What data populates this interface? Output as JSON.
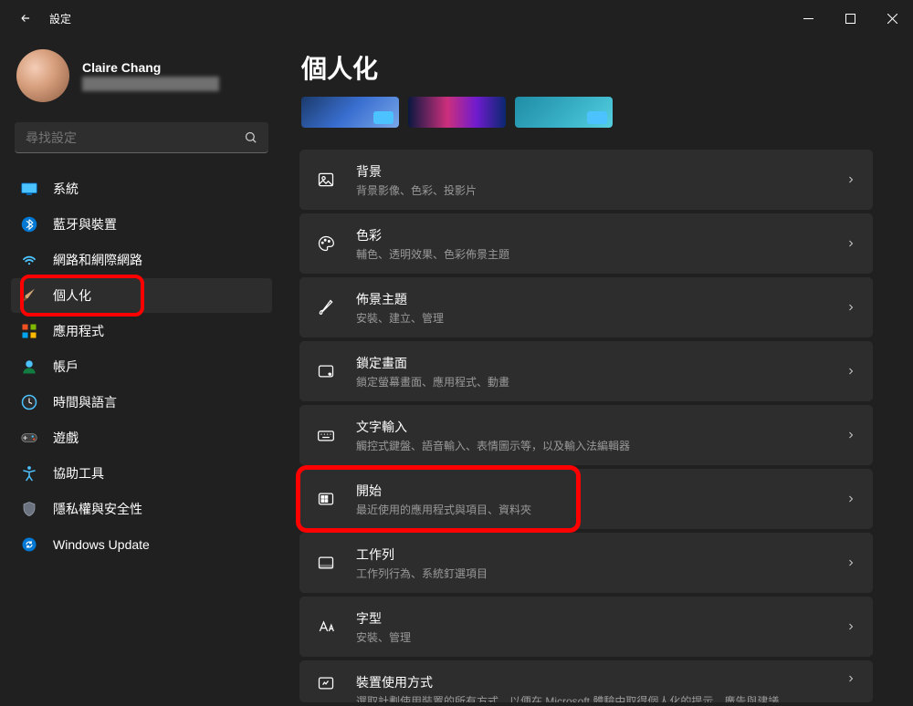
{
  "app": {
    "title": "設定"
  },
  "profile": {
    "name": "Claire Chang"
  },
  "search": {
    "placeholder": "尋找設定"
  },
  "sidebar": {
    "items": [
      {
        "label": "系統",
        "icon": "system"
      },
      {
        "label": "藍牙與裝置",
        "icon": "bluetooth"
      },
      {
        "label": "網路和網際網路",
        "icon": "wifi"
      },
      {
        "label": "個人化",
        "icon": "personalization",
        "active": true,
        "highlight": true
      },
      {
        "label": "應用程式",
        "icon": "apps"
      },
      {
        "label": "帳戶",
        "icon": "accounts"
      },
      {
        "label": "時間與語言",
        "icon": "time"
      },
      {
        "label": "遊戲",
        "icon": "gaming"
      },
      {
        "label": "協助工具",
        "icon": "accessibility"
      },
      {
        "label": "隱私權與安全性",
        "icon": "privacy"
      },
      {
        "label": "Windows Update",
        "icon": "update"
      }
    ]
  },
  "page": {
    "title": "個人化"
  },
  "settings": [
    {
      "title": "背景",
      "desc": "背景影像、色彩、投影片",
      "icon": "image"
    },
    {
      "title": "色彩",
      "desc": "輔色、透明效果、色彩佈景主題",
      "icon": "palette"
    },
    {
      "title": "佈景主題",
      "desc": "安裝、建立、管理",
      "icon": "brush"
    },
    {
      "title": "鎖定畫面",
      "desc": "鎖定螢幕畫面、應用程式、動畫",
      "icon": "lock"
    },
    {
      "title": "文字輸入",
      "desc": "觸控式鍵盤、語音輸入、表情圖示等，以及輸入法編輯器",
      "icon": "keyboard"
    },
    {
      "title": "開始",
      "desc": "最近使用的應用程式與項目、資料夾",
      "icon": "start",
      "highlight": true
    },
    {
      "title": "工作列",
      "desc": "工作列行為、系統釘選項目",
      "icon": "taskbar"
    },
    {
      "title": "字型",
      "desc": "安裝、管理",
      "icon": "font"
    },
    {
      "title": "裝置使用方式",
      "desc": "選取計劃使用裝置的所有方式，以便在 Microsoft 體驗中取得個人化的提示、廣告與建議",
      "icon": "usage",
      "partial": true
    }
  ]
}
